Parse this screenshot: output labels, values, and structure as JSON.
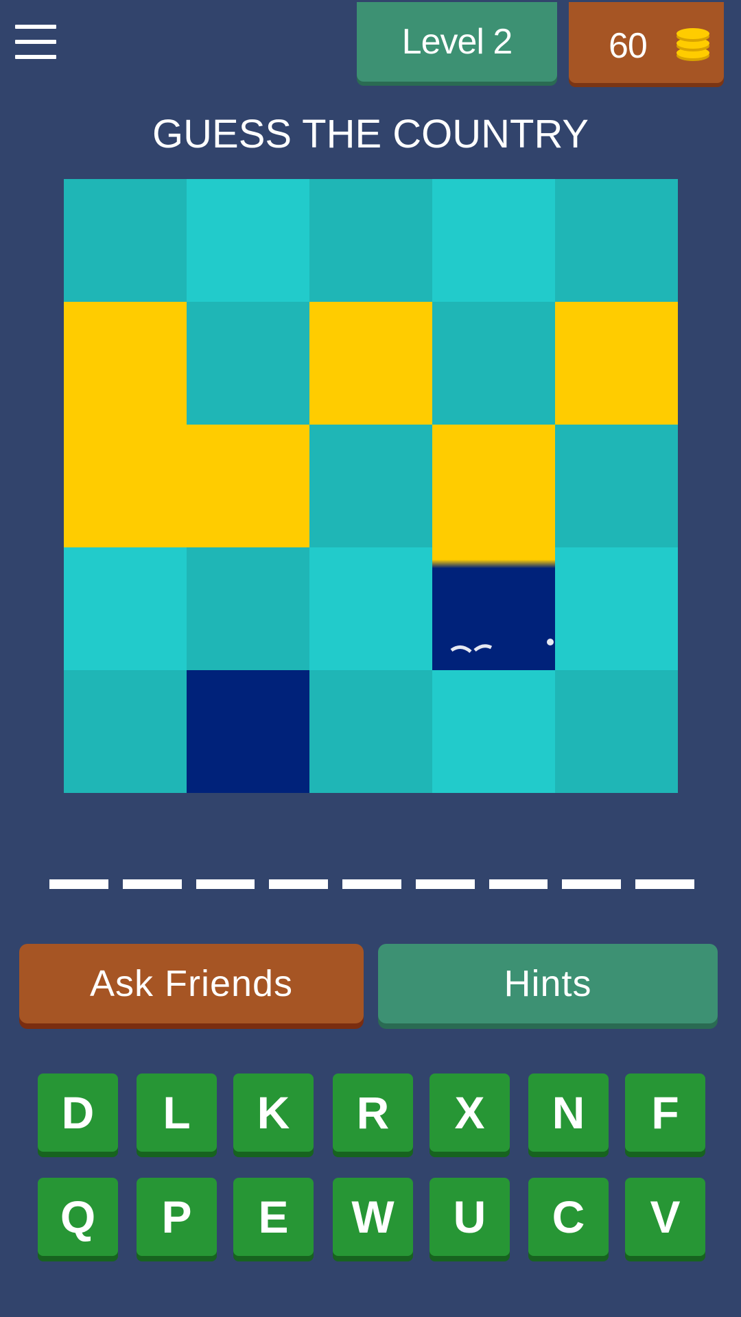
{
  "header": {
    "level_label": "Level 2",
    "coins": "60",
    "coin_icon": "coins-stack-icon",
    "menu_icon": "hamburger-menu-icon"
  },
  "title": "GUESS THE COUNTRY",
  "flag_grid": {
    "rows": 5,
    "cols": 5,
    "tiles": [
      "#1fb6b6",
      "#22cbcb",
      "#1fb6b6",
      "#22cbcb",
      "#1fb6b6",
      "#ffcc00",
      "#1fb6b6",
      "#ffcc00",
      "#1fb6b6",
      "#ffcc00",
      "#ffcc00",
      "#ffcc00",
      "#1fb6b6",
      "#ffcc00",
      "#1fb6b6",
      "#22cbcb",
      "#1fb6b6",
      "#22cbcb",
      "mixed",
      "#22cbcb",
      "#1fb6b6",
      "#00227a",
      "#1fb6b6",
      "#22cbcb",
      "#1fb6b6"
    ]
  },
  "answer": {
    "slot_count": 9
  },
  "buttons": {
    "ask_friends": "Ask Friends",
    "hints": "Hints"
  },
  "keyboard": {
    "row1": [
      "D",
      "L",
      "K",
      "R",
      "X",
      "N",
      "F"
    ],
    "row2": [
      "Q",
      "P",
      "E",
      "W",
      "U",
      "C",
      "V"
    ]
  },
  "colors": {
    "background": "#32446c",
    "green_accent": "#3d9173",
    "orange_accent": "#a65524",
    "key_green": "#279635",
    "flag_yellow": "#ffcc00",
    "flag_blue": "#00227a",
    "hidden_tile_dark": "#1fb6b6",
    "hidden_tile_light": "#22cbcb"
  }
}
